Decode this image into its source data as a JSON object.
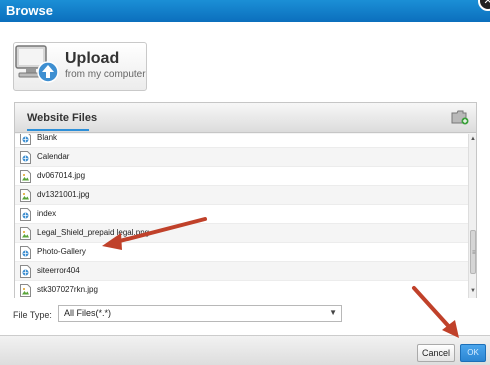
{
  "window": {
    "title": "Browse",
    "close_symbol": "✕"
  },
  "upload": {
    "title": "Upload",
    "subtitle": "from my computer"
  },
  "files_panel": {
    "tab_label": "Website Files",
    "files": [
      {
        "name": "Blank",
        "type": "page"
      },
      {
        "name": "Calendar",
        "type": "page"
      },
      {
        "name": "dv067014.jpg",
        "type": "image"
      },
      {
        "name": "dv1321001.jpg",
        "type": "image"
      },
      {
        "name": "index",
        "type": "page"
      },
      {
        "name": "Legal_Shield_prepaid legal.png",
        "type": "image"
      },
      {
        "name": "Photo-Gallery",
        "type": "page"
      },
      {
        "name": "siteerror404",
        "type": "page"
      },
      {
        "name": "stk307027rkn.jpg",
        "type": "image"
      }
    ]
  },
  "file_type": {
    "label": "File Type:",
    "selected": "All Files(*.*)"
  },
  "footer": {
    "cancel_label": "Cancel",
    "ok_label": "OK"
  },
  "colors": {
    "title_bar": "#0b6fbd",
    "accent": "#2d8fd8",
    "annotation_arrow": "#c0412a"
  }
}
